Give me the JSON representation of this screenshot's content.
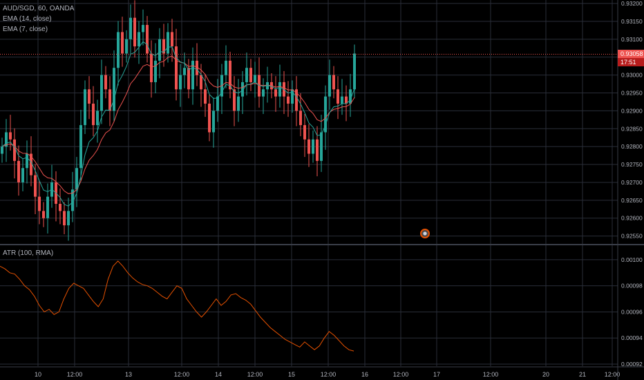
{
  "legend": {
    "symbol": "AUD/SGD, 60, OANDA",
    "ema14": "EMA (14, close)",
    "ema7": "EMA (7, close)",
    "atr": "ATR (100, RMA)"
  },
  "price_tag": {
    "value": "0.93058",
    "countdown": "17:51"
  },
  "colors": {
    "background": "#000000",
    "grid": "#2a2e39",
    "up": "#26a69a",
    "down": "#ef5350",
    "ema14": "#ef5350",
    "ema7": "#26a69a",
    "atr": "#e65100",
    "axis_text": "#b2b5be"
  },
  "chart_data": [
    {
      "type": "candlestick",
      "title": "AUD/SGD, 60, OANDA",
      "ylim": [
        0.9253,
        0.932
      ],
      "y_ticks": [
        "0.93200",
        "0.93150",
        "0.93100",
        "0.93050",
        "0.93000",
        "0.92950",
        "0.92900",
        "0.92850",
        "0.92800",
        "0.92750",
        "0.92700",
        "0.92650",
        "0.92600",
        "0.92550"
      ],
      "x_ticks": [
        "10",
        "12:00",
        "13",
        "12:00",
        "14",
        "12:00",
        "15",
        "12:00",
        "16",
        "12:00",
        "17",
        "12:00",
        "20",
        "21",
        "12:00"
      ],
      "close": [
        0.928,
        0.9284,
        0.9282,
        0.9276,
        0.927,
        0.9274,
        0.9278,
        0.9272,
        0.9266,
        0.9262,
        0.926,
        0.9266,
        0.927,
        0.9264,
        0.9262,
        0.9258,
        0.9262,
        0.9268,
        0.9274,
        0.9286,
        0.9296,
        0.9292,
        0.9286,
        0.929,
        0.93,
        0.9296,
        0.929,
        0.9302,
        0.9312,
        0.9306,
        0.931,
        0.9316,
        0.9308,
        0.9312,
        0.9314,
        0.9306,
        0.9298,
        0.9304,
        0.931,
        0.9306,
        0.9312,
        0.9308,
        0.9296,
        0.93,
        0.9302,
        0.9296,
        0.9304,
        0.93,
        0.9296,
        0.9292,
        0.9284,
        0.929,
        0.9294,
        0.93,
        0.9304,
        0.9296,
        0.929,
        0.9294,
        0.9298,
        0.9302,
        0.9298,
        0.93,
        0.9294,
        0.9296,
        0.9298,
        0.9296,
        0.9294,
        0.9298,
        0.9294,
        0.9292,
        0.9296,
        0.929,
        0.9286,
        0.9282,
        0.9278,
        0.9282,
        0.9276,
        0.9284,
        0.9294,
        0.93,
        0.9296,
        0.9292,
        0.9294,
        0.9292,
        0.9296,
        0.9306
      ]
    },
    {
      "type": "line",
      "title": "ATR (100, RMA)",
      "ylim": [
        0.00092,
        0.00101
      ],
      "y_ticks": [
        "0.00100",
        "0.00098",
        "0.00096",
        "0.00094",
        "0.00092"
      ],
      "values": [
        0.000995,
        0.000993,
        0.00099,
        0.000989,
        0.000985,
        0.00098,
        0.000977,
        0.000972,
        0.000965,
        0.00096,
        0.000962,
        0.000958,
        0.00096,
        0.00097,
        0.000978,
        0.000982,
        0.00098,
        0.000978,
        0.000973,
        0.000968,
        0.000964,
        0.00097,
        0.000985,
        0.000995,
        0.000999,
        0.000995,
        0.00099,
        0.000986,
        0.000983,
        0.000981,
        0.00098,
        0.000978,
        0.000975,
        0.000972,
        0.00097,
        0.000975,
        0.00098,
        0.000978,
        0.00097,
        0.000965,
        0.00096,
        0.000956,
        0.00096,
        0.000965,
        0.00097,
        0.000965,
        0.000968,
        0.000973,
        0.000974,
        0.000971,
        0.000969,
        0.000966,
        0.000961,
        0.000956,
        0.000952,
        0.000948,
        0.000945,
        0.000942,
        0.000939,
        0.000937,
        0.000935,
        0.000933,
        0.000937,
        0.000934,
        0.000931,
        0.000934,
        0.00094,
        0.000945,
        0.000942,
        0.000938,
        0.000934,
        0.000931,
        0.00093
      ]
    }
  ]
}
